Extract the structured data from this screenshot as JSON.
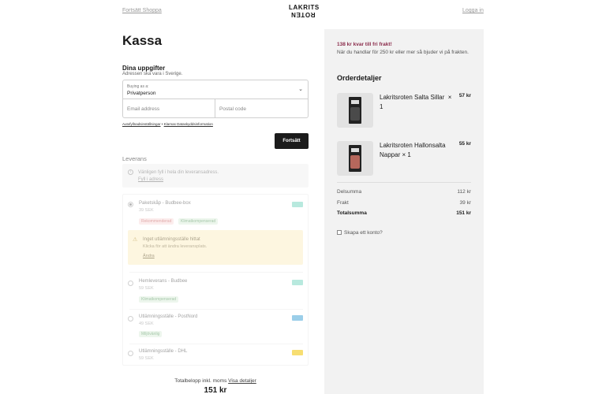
{
  "header": {
    "continue_shopping": "Fortsätt Shoppa",
    "logo_line1": "LAKRITS",
    "logo_line2": "ROTEN",
    "login": "Logga in"
  },
  "checkout": {
    "title": "Kassa",
    "details_title": "Dina uppgifter",
    "details_sub": "Adressen ska vara i Sverige.",
    "buying_as_label": "Buying as a:",
    "buying_as_value": "Privatperson",
    "email_placeholder": "Email address",
    "postal_placeholder": "Postal code",
    "link_autofill": "Autofyllnadsinställningar",
    "link_separator": " • ",
    "link_klarna": "Klarnas Dataskyddsinformation",
    "continue_button": "Fortsätt"
  },
  "delivery": {
    "title": "Leverans",
    "notice_text": "Vänligen fyll i hela din leveransadress.",
    "notice_link": "Fyll i adress",
    "options": [
      {
        "name": "Paketskåp - Budbee-box",
        "price": "39 SEK",
        "tags": [
          "Rekommenderad",
          "Klimatkompenserad"
        ],
        "tag_colors": [
          "red",
          "green"
        ],
        "selected": true,
        "carrier_color": "#7fd8c4"
      },
      {
        "name": "Hemleverans - Budbee",
        "price": "59 SEK",
        "tags": [
          "Klimatkompenserad"
        ],
        "tag_colors": [
          "green"
        ],
        "selected": false,
        "carrier_color": "#7fd8c4"
      },
      {
        "name": "Utlämningsställe - PostNord",
        "price": "49 SEK",
        "tags": [
          "Miljövänlig"
        ],
        "tag_colors": [
          "green"
        ],
        "selected": false,
        "carrier_color": "#4aa7d8"
      },
      {
        "name": "Utlämningsställe - DHL",
        "price": "59 SEK",
        "tags": [],
        "tag_colors": [],
        "selected": false,
        "carrier_color": "#f2c400"
      }
    ],
    "warning_title": "Inget utlämningsställe hittat",
    "warning_sub": "Klicka för att ändra leveransplats.",
    "warning_link": "Ändra"
  },
  "footer": {
    "total_label": "Totalbelopp inkl. moms",
    "total_link": "Visa detaljer",
    "total_amount": "151 kr"
  },
  "summary": {
    "free_shipping_title": "138 kr kvar till fri frakt!",
    "free_shipping_sub": "När du handlar för 250 kr eller mer så bjuder vi på frakten.",
    "order_title": "Orderdetaljer",
    "items": [
      {
        "name": "Lakritsroten Salta Sillar",
        "qty": "× 1",
        "price": "57 kr",
        "candy_color": "#4a4a4a"
      },
      {
        "name": "Lakritsroten Hallonsalta Nappar",
        "qty": "× 1",
        "price": "55 kr",
        "candy_color": "#b5675c"
      }
    ],
    "subtotal_label": "Delsumma",
    "subtotal_value": "112 kr",
    "shipping_label": "Frakt",
    "shipping_value": "39 kr",
    "total_label": "Totalsumma",
    "total_value": "151 kr",
    "create_account": "Skapa ett konto?"
  }
}
